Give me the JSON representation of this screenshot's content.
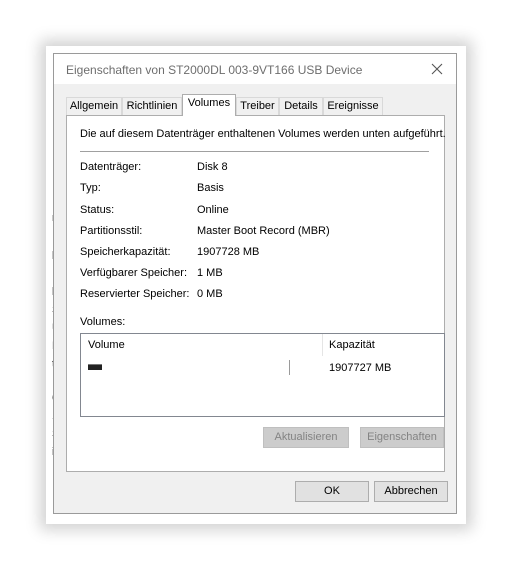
{
  "background": {
    "fragments": [
      "",
      "",
      "",
      "",
      "",
      "",
      "rk",
      "",
      "",
      "ll",
      "",
      "la",
      "S",
      "U",
      "DS",
      "tu",
      "",
      "6",
      "1",
      "S",
      "ig"
    ]
  },
  "dialog": {
    "title": "Eigenschaften von ST2000DL 003-9VT166 USB Device",
    "close_icon": "close-icon"
  },
  "tabs": [
    {
      "label": "Allgemein"
    },
    {
      "label": "Richtlinien"
    },
    {
      "label": "Volumes"
    },
    {
      "label": "Treiber"
    },
    {
      "label": "Details"
    },
    {
      "label": "Ereignisse"
    }
  ],
  "active_tab": "Volumes",
  "panel": {
    "description": "Die auf diesem Datenträger enthaltenen Volumes werden unten aufgeführt.",
    "properties": [
      {
        "label": "Datenträger:",
        "value": "Disk 8"
      },
      {
        "label": "Typ:",
        "value": "Basis"
      },
      {
        "label": "Status:",
        "value": "Online"
      },
      {
        "label": "Partitionsstil:",
        "value": "Master Boot Record (MBR)"
      },
      {
        "label": "Speicherkapazität:",
        "value": "1907728 MB"
      },
      {
        "label": "Verfügbarer Speicher:",
        "value": "1 MB"
      },
      {
        "label": "Reservierter Speicher:",
        "value": "0 MB"
      }
    ],
    "volumes_label": "Volumes:",
    "volumes_table": {
      "columns": [
        "Volume",
        "Kapazität"
      ],
      "rows": [
        {
          "volume": "",
          "icon": "drive-icon",
          "capacity": "1907727 MB"
        }
      ]
    },
    "buttons": {
      "refresh": "Aktualisieren",
      "properties": "Eigenschaften"
    }
  },
  "footer": {
    "ok": "OK",
    "cancel": "Abbrechen"
  }
}
